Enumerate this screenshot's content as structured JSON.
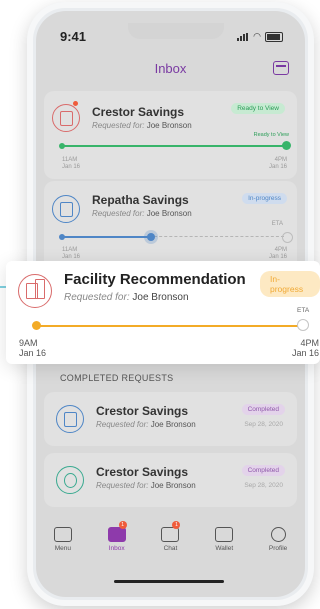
{
  "status_bar": {
    "time": "9:41"
  },
  "header": {
    "title": "Inbox"
  },
  "requests": [
    {
      "title": "Crestor Savings",
      "requested_prefix": "Requested for:",
      "requested_name": "Joe Bronson",
      "status": "Ready to View",
      "progress_label": "Ready to View",
      "start_time": "11AM",
      "start_date": "Jan 16",
      "end_time": "4PM",
      "end_date": "Jan 16"
    },
    {
      "title": "Repatha Savings",
      "requested_prefix": "Requested for:",
      "requested_name": "Joe Bronson",
      "status": "In-progress",
      "eta_label": "ETA",
      "start_time": "11AM",
      "start_date": "Jan 16",
      "end_time": "4PM",
      "end_date": "Jan 16"
    }
  ],
  "featured_request": {
    "title": "Facility Recommendation",
    "requested_prefix": "Requested for:",
    "requested_name": "Joe Bronson",
    "status": "In-progress",
    "eta_label": "ETA",
    "start_time": "9AM",
    "start_date": "Jan 16",
    "end_time": "4PM",
    "end_date": "Jan 16"
  },
  "completed": {
    "section_title": "COMPLETED REQUESTS",
    "items": [
      {
        "title": "Crestor Savings",
        "requested_prefix": "Requested for:",
        "requested_name": "Joe Bronson",
        "status": "Completed",
        "date": "Sep 28, 2020"
      },
      {
        "title": "Crestor Savings",
        "requested_prefix": "Requested for:",
        "requested_name": "Joe Bronson",
        "status": "Completed",
        "date": "Sep 28, 2020"
      }
    ]
  },
  "tabbar": {
    "items": [
      {
        "label": "Menu"
      },
      {
        "label": "Inbox",
        "badge": "1"
      },
      {
        "label": "Chat",
        "badge": "1"
      },
      {
        "label": "Wallet"
      },
      {
        "label": "Profile"
      }
    ]
  }
}
